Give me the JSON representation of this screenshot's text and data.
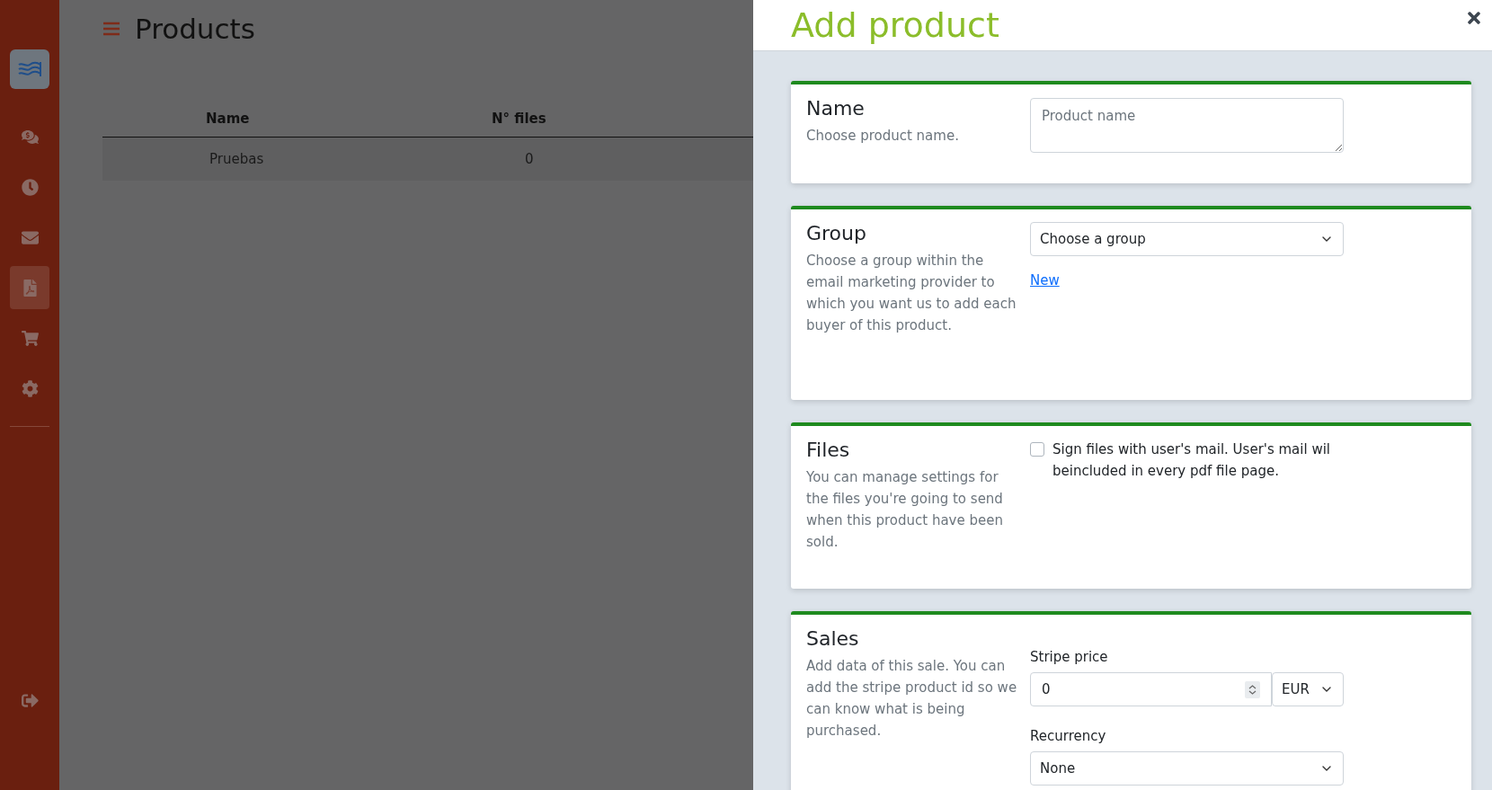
{
  "sidebar": {
    "items": [
      {
        "kind": "chat",
        "selected": false
      },
      {
        "kind": "clock",
        "selected": false
      },
      {
        "kind": "mail",
        "selected": false
      },
      {
        "kind": "pdf",
        "selected": true
      },
      {
        "kind": "cart",
        "selected": false
      },
      {
        "kind": "settings",
        "selected": false
      }
    ]
  },
  "page": {
    "title": "Products",
    "table": {
      "columns": [
        "Name",
        "N° files"
      ],
      "rows": [
        [
          "Pruebas",
          "0"
        ]
      ]
    }
  },
  "drawer": {
    "title": "Add product",
    "sections": [
      {
        "kind": "name",
        "title": "Name",
        "description": "Choose product name.",
        "placeholder": "Product name"
      },
      {
        "kind": "group",
        "title": "Group",
        "description": "Choose a group within the email marketing provider to which you want us to add each buyer of this product.",
        "value": "Choose a group",
        "link": "New"
      },
      {
        "kind": "files",
        "title": "Files",
        "description": "You can manage settings for the files you're going to send when this product have been sold.",
        "checkbox_label": "Sign files with user's mail. User's mail wil beincluded in every pdf file page.",
        "checked": false
      },
      {
        "kind": "sales",
        "title": "Sales",
        "description": "Add data of this sale. You can add the stripe product id so we can know what is being purchased.",
        "price_label": "Stripe price",
        "price": "0",
        "currency": "EUR",
        "recurrency_label": "Recurrency",
        "recurrency": "None"
      }
    ]
  }
}
